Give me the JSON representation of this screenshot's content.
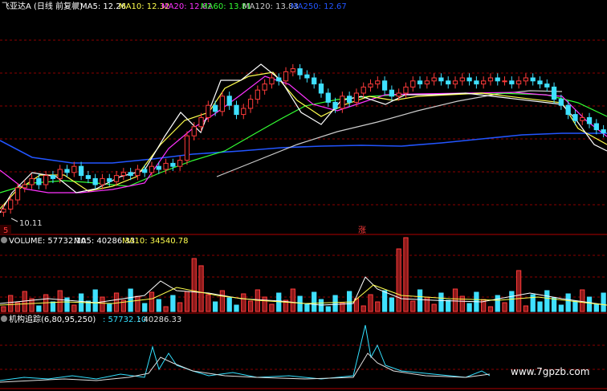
{
  "colors": {
    "background": "#000000",
    "up": "#ff3b3b",
    "down": "#3fe0ff",
    "grid": "#8b0000",
    "ma5": "#ffffff",
    "ma10": "#ffff4d",
    "ma20": "#ff33ff",
    "ma60": "#33ff33",
    "ma120": "#bbbbbb",
    "ma250": "#2255ff",
    "ind1": "#33e0ff",
    "ind2": "#e0e0e0"
  },
  "header": {
    "title": "飞亚达A (日线 前复权)",
    "ma5": "MA5: 12.26",
    "ma10": "MA10: 12.32",
    "ma20": "MA20: 12.62",
    "ma60": "MA60: 13.81",
    "ma120": "MA120: 13.83",
    "ma250": "MA250: 12.67"
  },
  "price_panel": {
    "low_label": "10.11",
    "marker_left": "5",
    "marker_mid": "涨"
  },
  "volume_panel": {
    "title": "VOLUME: 57732.10",
    "ma5": "MA5: 40286.33",
    "ma10": "MA10: 34540.78"
  },
  "indicator_panel": {
    "title": "机构追踪(6,80,95,250)",
    "value1": ": 57732.10",
    "value2": ": 40286.33"
  },
  "watermark": "www.7gpzb.com",
  "icons": [
    "gear-icon",
    "gear-icon",
    "gear-icon"
  ],
  "chart_data": {
    "type": "candlestick",
    "price_low": 10.11,
    "price_range": [
      10,
      15
    ],
    "closes": [
      10.2,
      10.5,
      10.9,
      11.0,
      11.2,
      11.0,
      11.3,
      11.2,
      11.5,
      11.4,
      11.6,
      11.3,
      11.2,
      11.0,
      11.2,
      11.1,
      11.3,
      11.4,
      11.3,
      11.5,
      11.4,
      11.6,
      11.5,
      11.7,
      11.6,
      11.8,
      12.6,
      12.9,
      13.2,
      13.6,
      13.4,
      13.9,
      13.6,
      13.3,
      13.5,
      13.8,
      14.1,
      14.3,
      14.5,
      14.4,
      14.7,
      14.8,
      14.6,
      14.5,
      14.3,
      14.0,
      13.7,
      13.5,
      13.9,
      13.7,
      14.0,
      14.2,
      14.3,
      14.4,
      14.1,
      13.9,
      14.0,
      14.2,
      14.4,
      14.3,
      14.4,
      14.5,
      14.4,
      14.3,
      14.4,
      14.5,
      14.4,
      14.3,
      14.4,
      14.5,
      14.4,
      14.4,
      14.3,
      14.4,
      14.5,
      14.4,
      14.3,
      14.2,
      13.8,
      13.6,
      13.3,
      13.1,
      13.2,
      13.0,
      12.8,
      12.7
    ]
  }
}
